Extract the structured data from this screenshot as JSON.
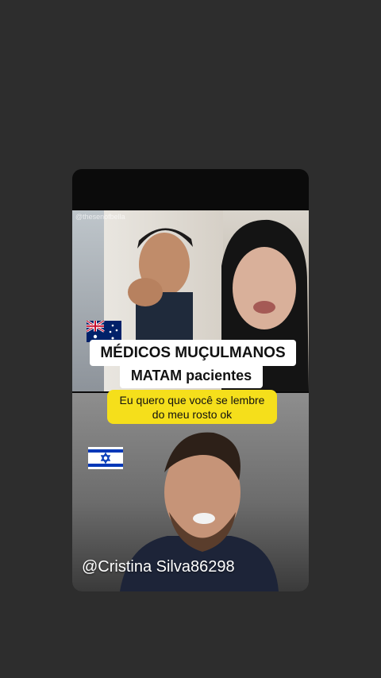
{
  "captions": {
    "line1": "MÉDICOS MUÇULMANOS",
    "line2": "MATAM pacientes"
  },
  "subtitle": {
    "line1": "Eu quero que você se lembre",
    "line2": "do meu rosto ok"
  },
  "handle": "@Cristina Silva86298",
  "watermark": "@thesenofbella",
  "flags": {
    "top": "australia-flag",
    "bottom": "israel-flag"
  },
  "colors": {
    "background": "#2d2d2d",
    "subtitle_bg": "#f5df1b",
    "caption_bg": "#ffffff"
  }
}
